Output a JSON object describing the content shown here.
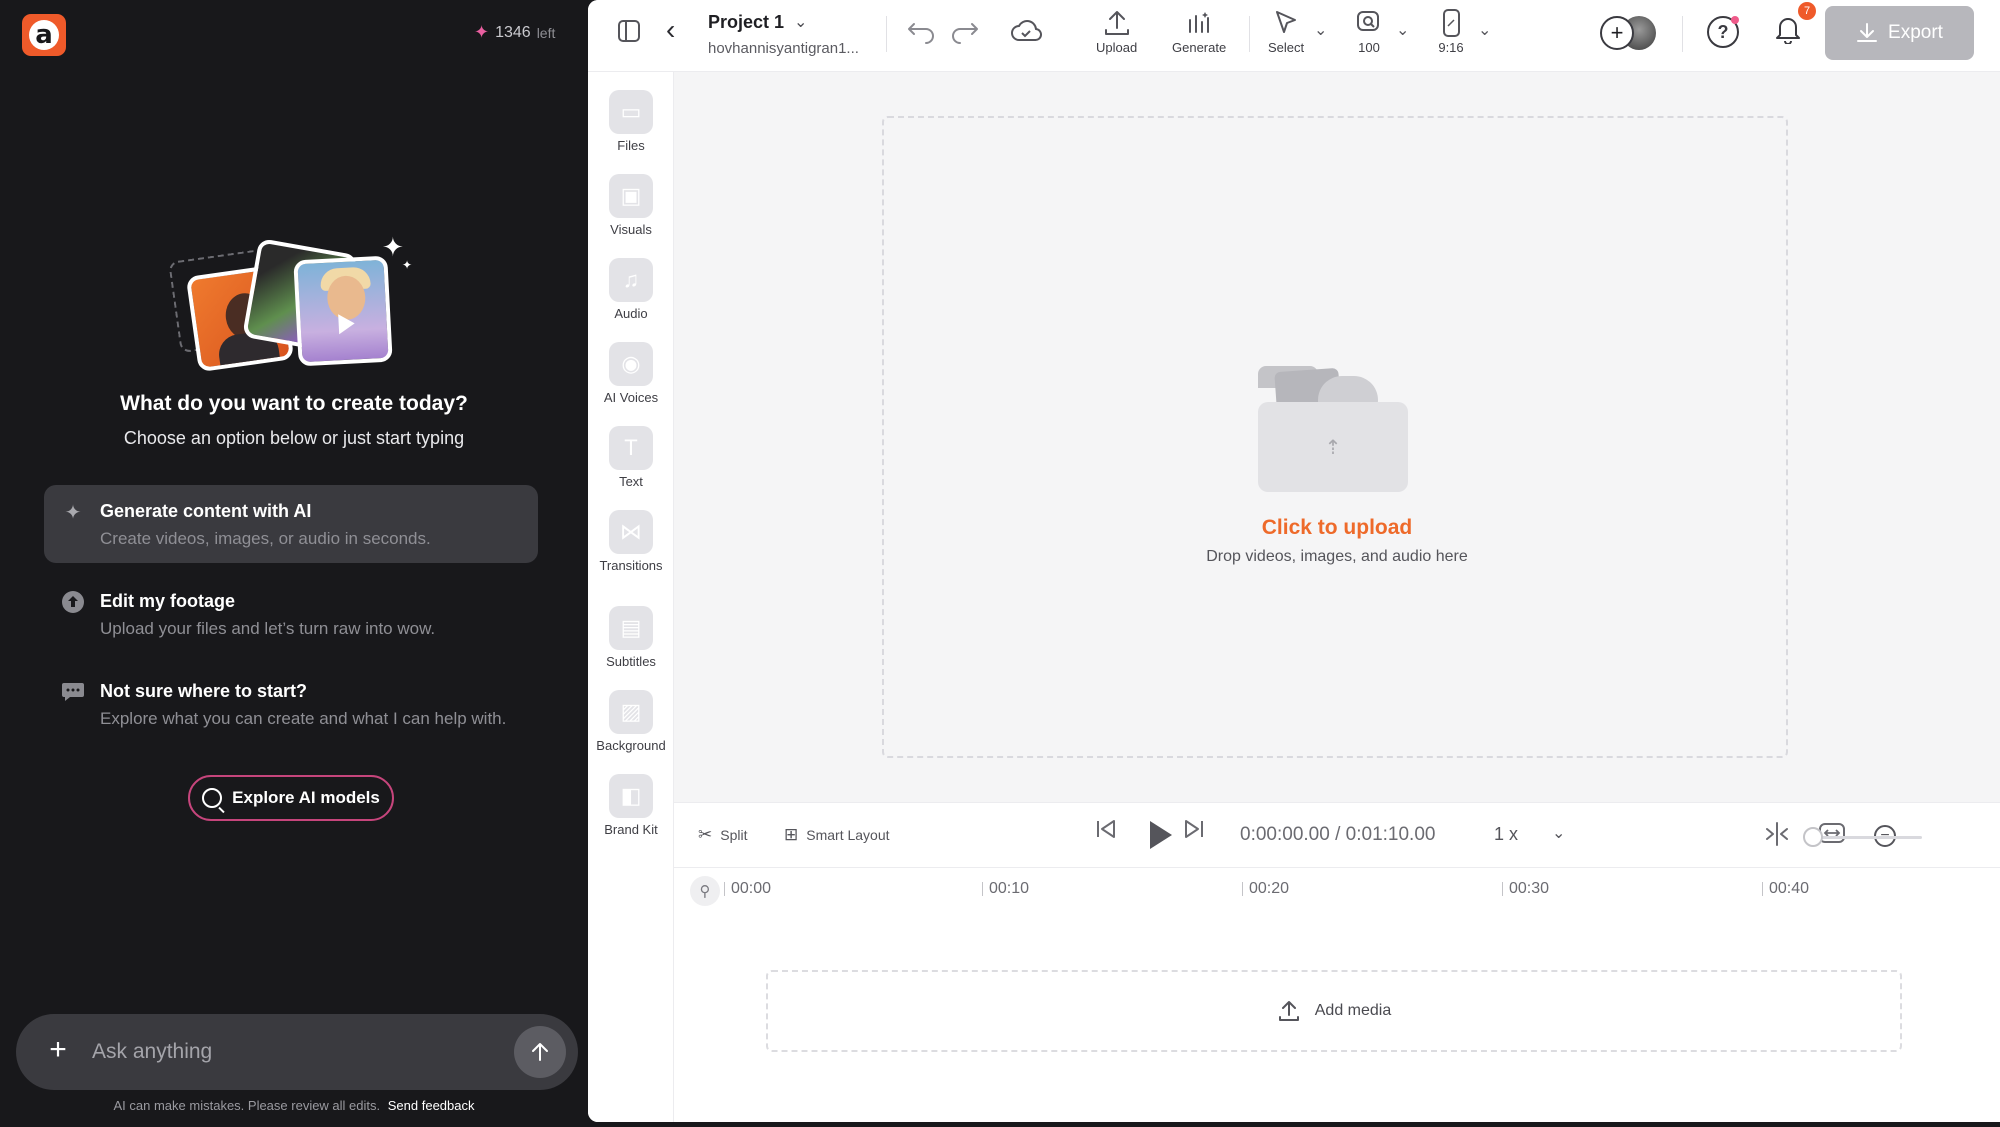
{
  "assistant": {
    "credits_count": "1346",
    "credits_suffix": "left",
    "heading": "What do you want to create today?",
    "subheading": "Choose an option below or just start typing",
    "options": [
      {
        "title": "Generate content with AI",
        "desc": "Create videos, images, or audio in seconds."
      },
      {
        "title": "Edit my footage",
        "desc": "Upload your files and let’s turn raw into wow."
      },
      {
        "title": "Not sure where to start?",
        "desc": "Explore what you can create and what I can help with."
      }
    ],
    "explore_label": "Explore AI models",
    "ask_placeholder": "Ask anything",
    "disclaimer": "AI can make mistakes. Please review all edits.",
    "feedback_link": "Send feedback"
  },
  "topbar": {
    "project_name": "Project 1",
    "project_user": "hovhannisyantigran1...",
    "upload_label": "Upload",
    "generate_label": "Generate",
    "select_label": "Select",
    "zoom_label": "100",
    "ratio_label": "9:16",
    "notification_count": "7",
    "export_label": "Export"
  },
  "rail": {
    "items": [
      "Files",
      "Visuals",
      "Audio",
      "AI Voices",
      "Text",
      "Transitions",
      "Subtitles",
      "Background",
      "Brand Kit"
    ]
  },
  "canvas": {
    "upload_title": "Click to upload",
    "upload_sub": "Drop videos, images, and audio here"
  },
  "timeline": {
    "split_label": "Split",
    "smart_layout_label": "Smart Layout",
    "current_time": "0:00:00.00",
    "time_separator": "/",
    "total_time": "0:01:10.00",
    "speed": "1 x",
    "ticks": [
      "00:00",
      "00:10",
      "00:20",
      "00:30",
      "00:40"
    ],
    "add_media_label": "Add media"
  },
  "colors": {
    "accent": "#ee6a2a",
    "panel_dark": "#18181b",
    "explore_border": "#c6457c"
  }
}
